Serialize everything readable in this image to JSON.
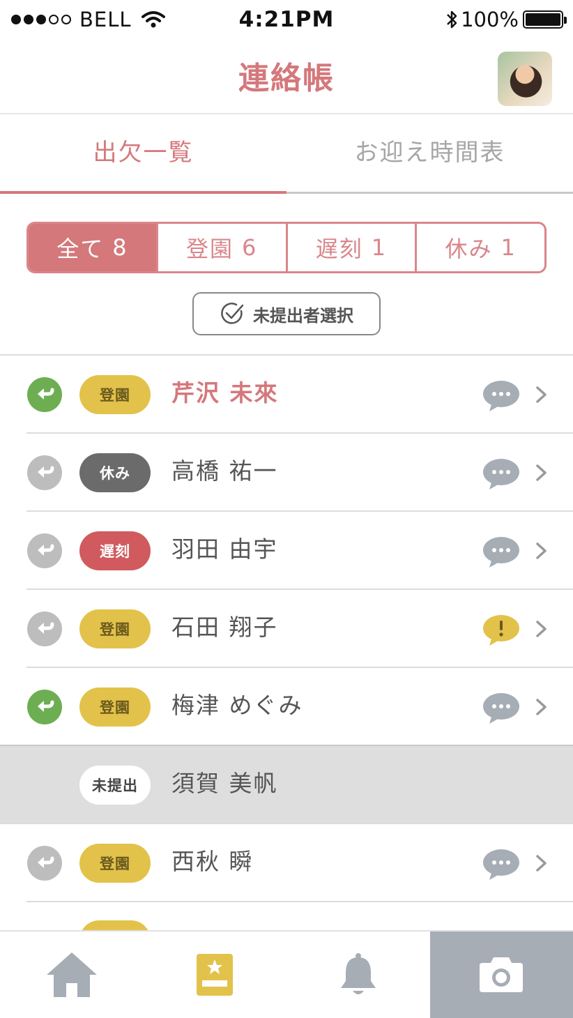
{
  "status_bar": {
    "carrier": "BELL",
    "time": "4:21PM",
    "battery": "100%"
  },
  "header": {
    "title": "連絡帳"
  },
  "tabs": [
    {
      "label": "出欠一覧",
      "active": true
    },
    {
      "label": "お迎え時間表",
      "active": false
    }
  ],
  "filters": [
    {
      "label": "全て",
      "count": "8",
      "active": true
    },
    {
      "label": "登園",
      "count": "6",
      "active": false
    },
    {
      "label": "遅刻",
      "count": "1",
      "active": false
    },
    {
      "label": "休み",
      "count": "1",
      "active": false
    }
  ],
  "select_button": {
    "label": "未提出者選択"
  },
  "students": [
    {
      "name": "芹沢 未來",
      "status": "登園",
      "pickup": "green",
      "message": "comment",
      "highlighted": true
    },
    {
      "name": "高橋 祐一",
      "status": "休み",
      "pickup": "gray",
      "message": "comment",
      "highlighted": false
    },
    {
      "name": "羽田 由宇",
      "status": "遅刻",
      "pickup": "gray",
      "message": "comment",
      "highlighted": false
    },
    {
      "name": "石田 翔子",
      "status": "登園",
      "pickup": "gray",
      "message": "alert",
      "highlighted": false
    },
    {
      "name": "梅津 めぐみ",
      "status": "登園",
      "pickup": "green",
      "message": "comment",
      "highlighted": false
    },
    {
      "name": "須賀 美帆",
      "status": "未提出",
      "pickup": "none",
      "message": "none",
      "highlighted": false
    },
    {
      "name": "西秋 瞬",
      "status": "登園",
      "pickup": "gray",
      "message": "comment",
      "highlighted": false
    }
  ],
  "colors": {
    "accent": "#d4787c",
    "attend": "#e2c24a",
    "absent": "#6b6b6b",
    "late": "#d05a5e",
    "pickup_done": "#6dae52",
    "pickup_pending": "#bdbdbd"
  },
  "bottom_nav": [
    {
      "icon": "home-icon",
      "active": false
    },
    {
      "icon": "contact-book-icon",
      "active": true
    },
    {
      "icon": "bell-icon",
      "active": false
    },
    {
      "icon": "camera-icon",
      "active": false
    }
  ]
}
